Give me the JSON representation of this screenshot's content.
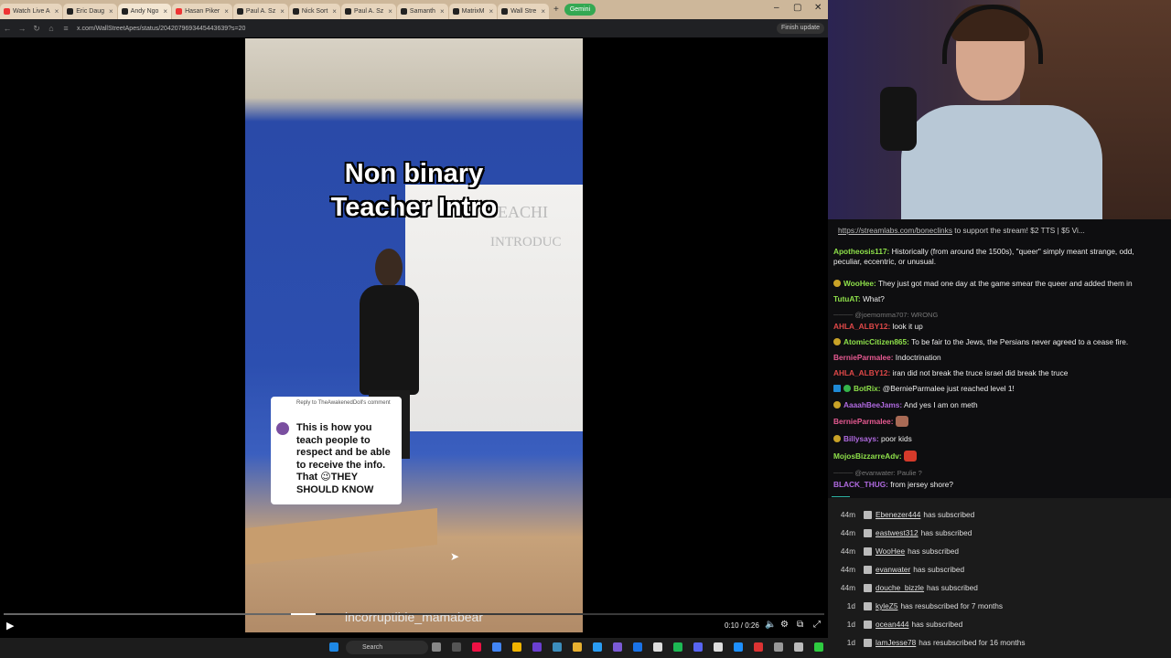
{
  "browser": {
    "tabs": [
      {
        "label": "Watch Live A",
        "active": false,
        "icon": "red"
      },
      {
        "label": "Eric Daug",
        "active": false,
        "icon": "x"
      },
      {
        "label": "Andy Ngo",
        "active": true,
        "icon": "x"
      },
      {
        "label": "Hasan Piker",
        "active": false,
        "icon": "red"
      },
      {
        "label": "Paul A. Sz",
        "active": false,
        "icon": "x"
      },
      {
        "label": "Nick Sort",
        "active": false,
        "icon": "x"
      },
      {
        "label": "Paul A. Sz",
        "active": false,
        "icon": "x"
      },
      {
        "label": "Samanth",
        "active": false,
        "icon": "x"
      },
      {
        "label": "MatrixM",
        "active": false,
        "icon": "x"
      },
      {
        "label": "Wall Stre",
        "active": false,
        "icon": "x"
      }
    ],
    "gemini_label": "Gemini",
    "url": "x.com/WallStreetApes/status/2042079693445443639?s=20",
    "finish_update_label": "Finish update"
  },
  "video": {
    "overlay_title_line1": "Non binary",
    "overlay_title_line2": "Teacher Intro",
    "wall_text1": "TEACHI",
    "wall_text2": "INTRODUC",
    "comment_reply_to": "Reply to TheAwakenedDoll's comment",
    "comment_text": "This is how you teach people to respect and be able to receive the info. That 😉THEY SHOULD KNOW",
    "watermark": "incorruptible_mamabear",
    "time": "0:10 / 0:26",
    "progress_fraction": 0.38
  },
  "taskbar": {
    "search_label": "Search"
  },
  "chat": {
    "banner_link": "https://streamlabs.com/boneclinks",
    "banner_text": " to support the stream! $2 TTS | $5 Vi...",
    "messages": [
      {
        "user": "Apotheosis117:",
        "color": "#8ee04a",
        "text": " Historically (from around the 1500s), \"queer\" simply meant strange, odd, peculiar, eccentric, or unusual.",
        "badge": ""
      },
      {
        "user": "WooHee:",
        "color": "#8ee04a",
        "text": " They just got mad one day at the game smear the queer and added them in",
        "badge": "gold"
      },
      {
        "user": "TutuAT:",
        "color": "#8ee04a",
        "text": " What?",
        "badge": ""
      },
      {
        "reply": "@joemomma707: WRONG"
      },
      {
        "user": "AHLA_ALBY12:",
        "color": "#e04848",
        "text": " look it up",
        "badge": ""
      },
      {
        "user": "AtomicCitizen865:",
        "color": "#8ee04a",
        "text": " To be fair to the Jews, the Persians never agreed to a cease fire.",
        "badge": "gold"
      },
      {
        "user": "BernieParmalee:",
        "color": "#e75a92",
        "text": " Indoctrination",
        "badge": ""
      },
      {
        "user": "AHLA_ALBY12:",
        "color": "#e04848",
        "text": " iran did not break the truce israel did break the truce",
        "badge": ""
      },
      {
        "user": "BotRix:",
        "color": "#8ee04a",
        "text": " @BernieParmalee just reached level 1!",
        "badge": "bot"
      },
      {
        "user": "AaaahBeeJams:",
        "color": "#b06ae0",
        "text": " And yes I am on meth",
        "badge": "gold"
      },
      {
        "user": "BernieParmalee:",
        "color": "#e75a92",
        "text": " ",
        "badge": "",
        "emote": "#a86a55"
      },
      {
        "user": "Billysays:",
        "color": "#b06ae0",
        "text": " poor kids",
        "badge": "gold"
      },
      {
        "user": "MojosBizzarreAdv:",
        "color": "#8ee04a",
        "text": " ",
        "badge": "",
        "emote": "#d53a2a"
      },
      {
        "reply": "@evanwater: Paulie ?"
      },
      {
        "user": "BLACK_THUG:",
        "color": "#b06ae0",
        "text": " from jersey shore?",
        "badge": ""
      }
    ]
  },
  "subs": [
    {
      "time": "44m",
      "name": "Ebenezer444",
      "text": "has subscribed"
    },
    {
      "time": "44m",
      "name": "eastwest312",
      "text": "has subscribed"
    },
    {
      "time": "44m",
      "name": "WooHee",
      "text": "has subscribed"
    },
    {
      "time": "44m",
      "name": "evanwater",
      "text": "has subscribed"
    },
    {
      "time": "44m",
      "name": "douche_bizzle",
      "text": "has subscribed"
    },
    {
      "time": "1d",
      "name": "kyleZ5",
      "text": "has resubscribed for 7 months"
    },
    {
      "time": "1d",
      "name": "ocean444",
      "text": "has subscribed"
    },
    {
      "time": "1d",
      "name": "lamJesse78",
      "text": "has resubscribed for 16 months"
    }
  ]
}
